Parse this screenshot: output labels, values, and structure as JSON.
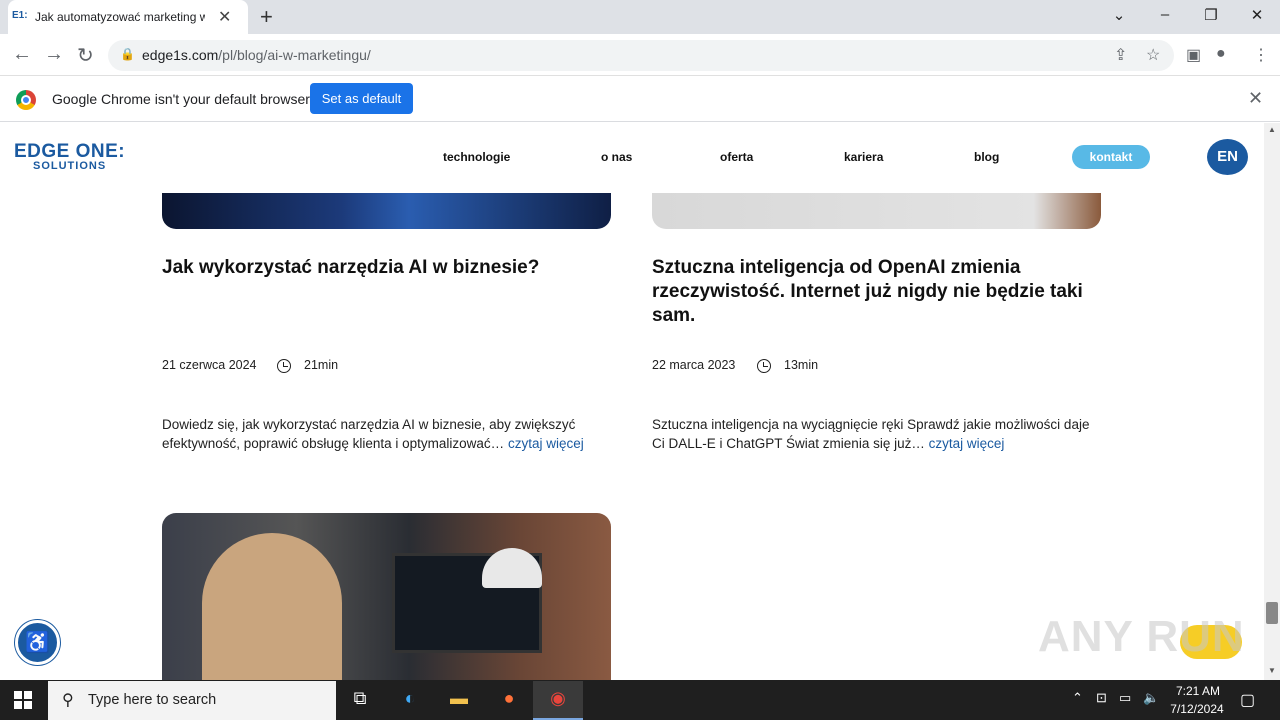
{
  "browser": {
    "tab_favicon": "E1:",
    "tab_title": "Jak automatyzować marketing w",
    "url_host": "edge1s.com",
    "url_path": "/pl/blog/ai-w-marketingu/"
  },
  "infobar": {
    "message": "Google Chrome isn't your default browser",
    "button": "Set as default"
  },
  "site": {
    "logo_main": "EDGE ONE:",
    "logo_sub": "SOLUTIONS",
    "nav": [
      "technologie",
      "o nas",
      "oferta",
      "kariera",
      "blog"
    ],
    "contact": "kontakt",
    "lang": "EN"
  },
  "posts": [
    {
      "title": "Jak wykorzystać narzędzia AI w biznesie?",
      "date": "21 czerwca 2024",
      "read_time": "21min",
      "excerpt_l1": "Dowiedz się, jak wykorzystać narzędzia AI w biznesie, aby zwiększyć",
      "excerpt_l2": "efektywność, poprawić obsługę klienta i optymalizować…",
      "read_more": "czytaj więcej"
    },
    {
      "title_l1": "Sztuczna inteligencja od OpenAI zmienia",
      "title_l2": "rzeczywistość. Internet już nigdy nie będzie taki",
      "title_l3": "sam.",
      "date": "22 marca 2023",
      "read_time": "13min",
      "excerpt_l1": "Sztuczna inteligencja na wyciągnięcie ręki Sprawdź jakie możliwości daje",
      "excerpt_l2": "Ci DALL-E i ChatGPT Świat zmienia się już…",
      "read_more": "czytaj więcej"
    }
  ],
  "watermark": "ANY RUN",
  "taskbar": {
    "search_placeholder": "Type here to search",
    "time": "7:21 AM",
    "date": "7/12/2024"
  },
  "colors": {
    "brand": "#1b5aa0",
    "contact_bg": "#58b9e6",
    "chrome_blue": "#1a73e8"
  }
}
